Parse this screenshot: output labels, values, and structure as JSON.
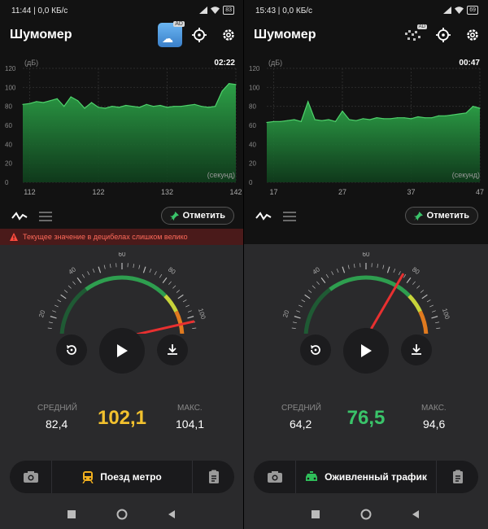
{
  "colors": {
    "chart_green": "#2ea84a",
    "gauge_green": "#2e9e4f",
    "gauge_orange": "#e07a1f",
    "needle_red": "#e83030",
    "value_yellow": "#f2c12e",
    "value_green": "#3ac46a",
    "warning_red": "#ff6a5a",
    "tram_yellow": "#f2b01e",
    "taxi_green": "#2fbf5a"
  },
  "screens": [
    {
      "status": {
        "time": "11:44",
        "net": "0,0 КБ/с",
        "battery": "83"
      },
      "app_title": "Шумомер",
      "ad_badge": "AD",
      "chart": {
        "unit": "(дБ)",
        "elapsed": "02:22",
        "x_unit": "(секунд)",
        "y_ticks": [
          "120",
          "100",
          "80",
          "60",
          "40",
          "20",
          "0"
        ],
        "x_ticks": [
          "112",
          "122",
          "132",
          "142"
        ]
      },
      "chart_data": {
        "type": "area",
        "title": "",
        "xlabel": "(секунд)",
        "ylabel": "(дБ)",
        "xlim": [
          111,
          142
        ],
        "ylim": [
          0,
          120
        ],
        "grid": true,
        "x": [
          111,
          112,
          113,
          114,
          115,
          116,
          117,
          118,
          119,
          120,
          121,
          122,
          123,
          124,
          125,
          126,
          127,
          128,
          129,
          130,
          131,
          132,
          133,
          134,
          135,
          136,
          137,
          138,
          139,
          140,
          141,
          142
        ],
        "y": [
          82,
          83,
          85,
          84,
          86,
          88,
          80,
          90,
          86,
          78,
          84,
          79,
          78,
          80,
          79,
          81,
          80,
          79,
          82,
          80,
          81,
          79,
          80,
          80,
          81,
          82,
          80,
          79,
          80,
          96,
          104,
          103
        ]
      },
      "mark_label": "Отметить",
      "warning": "Текущее значение в децибелах слишком велико",
      "gauge": {
        "ticks": [
          "0",
          "20",
          "40",
          "60",
          "80",
          "100",
          "120"
        ],
        "needle_db": 102.1
      },
      "stats": {
        "avg_label": "СРЕДНИЙ",
        "avg": "82,4",
        "current": "102,1",
        "max_label": "МАКС.",
        "max": "104,1"
      },
      "preset_label": "Поезд метро",
      "preset_icon": "tram-icon"
    },
    {
      "status": {
        "time": "15:43",
        "net": "0,0 КБ/с",
        "battery": "69"
      },
      "app_title": "Шумомер",
      "ad_badge": "AD",
      "chart": {
        "unit": "(дБ)",
        "elapsed": "00:47",
        "x_unit": "(секунд)",
        "y_ticks": [
          "120",
          "100",
          "80",
          "60",
          "40",
          "20",
          "0"
        ],
        "x_ticks": [
          "17",
          "27",
          "37",
          "47"
        ]
      },
      "chart_data": {
        "type": "area",
        "title": "",
        "xlabel": "(секунд)",
        "ylabel": "(дБ)",
        "xlim": [
          16,
          47
        ],
        "ylim": [
          0,
          120
        ],
        "grid": true,
        "x": [
          16,
          17,
          18,
          19,
          20,
          21,
          22,
          23,
          24,
          25,
          26,
          27,
          28,
          29,
          30,
          31,
          32,
          33,
          34,
          35,
          36,
          37,
          38,
          39,
          40,
          41,
          42,
          43,
          44,
          45,
          46,
          47
        ],
        "y": [
          63,
          64,
          64,
          65,
          66,
          64,
          85,
          66,
          65,
          66,
          64,
          75,
          66,
          65,
          67,
          66,
          68,
          67,
          67,
          68,
          68,
          67,
          69,
          68,
          68,
          70,
          70,
          71,
          72,
          73,
          80,
          78
        ]
      },
      "mark_label": "Отметить",
      "warning": "",
      "gauge": {
        "ticks": [
          "0",
          "20",
          "40",
          "60",
          "80",
          "100",
          "120"
        ],
        "needle_db": 76.5
      },
      "stats": {
        "avg_label": "СРЕДНИЙ",
        "avg": "64,2",
        "current": "76,5",
        "max_label": "МАКС.",
        "max": "94,6"
      },
      "preset_label": "Оживленный трафик",
      "preset_icon": "taxi-icon"
    }
  ]
}
